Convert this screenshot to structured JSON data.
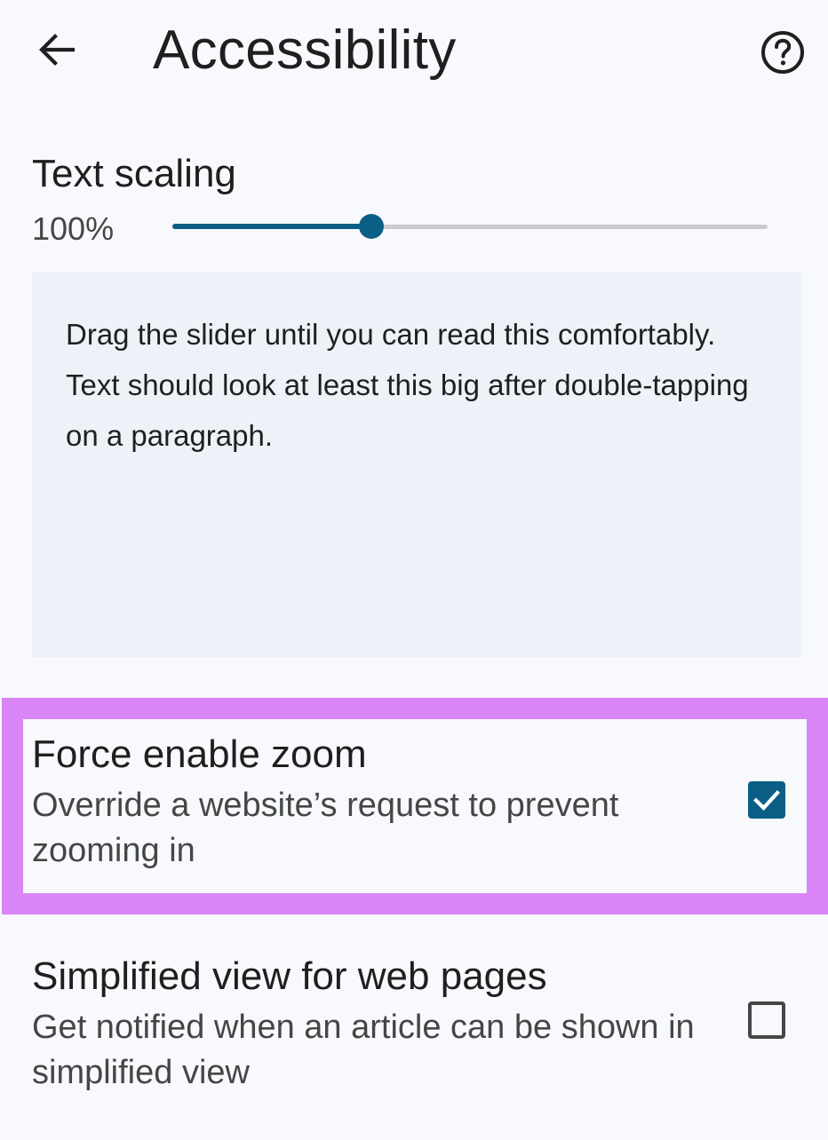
{
  "header": {
    "title": "Accessibility"
  },
  "text_scaling": {
    "title": "Text scaling",
    "value_label": "100%",
    "slider_fraction": 0.335,
    "preview_text": "Drag the slider until you can read this comfortably. Text should look at least this big after double-tapping on a paragraph."
  },
  "preferences": [
    {
      "title": "Force enable zoom",
      "description": "Override a website’s request to prevent zooming in",
      "checked": true,
      "highlighted": true
    },
    {
      "title": "Simplified view for web pages",
      "description": "Get notified when an article can be shown in simplified view",
      "checked": false,
      "highlighted": false
    }
  ],
  "icons": {
    "back": "arrow-back-icon",
    "help": "help-circle-icon",
    "check": "check-icon"
  },
  "colors": {
    "accent": "#0b5f86",
    "highlight": "#d985f6",
    "background": "#f8f9fd",
    "preview_background": "#eef2f8"
  }
}
